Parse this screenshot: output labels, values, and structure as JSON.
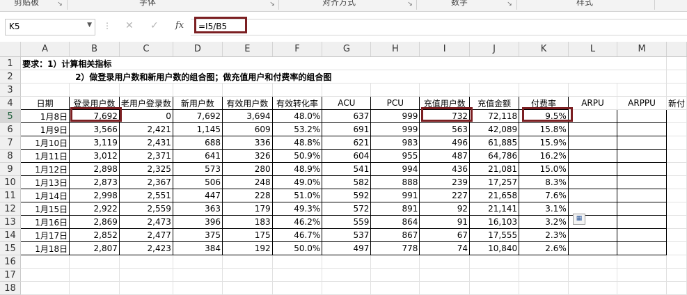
{
  "ribbon": {
    "groups": [
      "剪贴板",
      "字体",
      "对齐方式",
      "数字",
      "样式"
    ]
  },
  "formula_bar": {
    "name_box": "K5",
    "cancel_icon": "✕",
    "enter_icon": "✓",
    "fx_label": "fx",
    "formula": "=I5/B5"
  },
  "sheet": {
    "columns": [
      "A",
      "B",
      "C",
      "D",
      "E",
      "F",
      "G",
      "H",
      "I",
      "J",
      "K",
      "L",
      "M",
      ""
    ],
    "rows": [
      "1",
      "2",
      "3",
      "4",
      "5",
      "6",
      "7",
      "8",
      "9",
      "10",
      "11",
      "12",
      "13",
      "14",
      "15",
      "16",
      "17",
      "18"
    ],
    "requirement_line1": "要求：1）计算相关指标",
    "requirement_line2": "2）做登录用户数和新用户数的组合图；做充值用户和付费率的组合图",
    "headers": [
      "日期",
      "登录用户数",
      "老用户登录数",
      "新用户数",
      "有效用户数",
      "有效转化率",
      "ACU",
      "PCU",
      "充值用户数",
      "充值金额",
      "付费率",
      "ARPU",
      "ARPPU",
      "新付"
    ],
    "data": [
      [
        "1月8日",
        "7,692",
        "0",
        "7,692",
        "3,694",
        "48.0%",
        "637",
        "999",
        "732",
        "72,118",
        "9.5%"
      ],
      [
        "1月9日",
        "3,566",
        "2,421",
        "1,145",
        "609",
        "53.2%",
        "691",
        "999",
        "563",
        "42,089",
        "15.8%"
      ],
      [
        "1月10日",
        "3,119",
        "2,431",
        "688",
        "336",
        "48.8%",
        "621",
        "983",
        "496",
        "61,885",
        "15.9%"
      ],
      [
        "1月11日",
        "3,012",
        "2,371",
        "641",
        "326",
        "50.9%",
        "604",
        "955",
        "487",
        "64,786",
        "16.2%"
      ],
      [
        "1月12日",
        "2,898",
        "2,325",
        "573",
        "280",
        "48.9%",
        "541",
        "994",
        "436",
        "21,081",
        "15.0%"
      ],
      [
        "1月13日",
        "2,873",
        "2,367",
        "506",
        "248",
        "49.0%",
        "582",
        "888",
        "239",
        "17,257",
        "8.3%"
      ],
      [
        "1月14日",
        "2,998",
        "2,551",
        "447",
        "228",
        "51.0%",
        "592",
        "991",
        "227",
        "21,658",
        "7.6%"
      ],
      [
        "1月15日",
        "2,922",
        "2,559",
        "363",
        "179",
        "49.3%",
        "572",
        "891",
        "92",
        "21,141",
        "3.1%"
      ],
      [
        "1月16日",
        "2,869",
        "2,473",
        "396",
        "183",
        "46.2%",
        "559",
        "864",
        "91",
        "16,103",
        "3.2%"
      ],
      [
        "1月17日",
        "2,852",
        "2,477",
        "375",
        "175",
        "46.7%",
        "537",
        "867",
        "67",
        "17,555",
        "2.3%"
      ],
      [
        "1月18日",
        "2,807",
        "2,423",
        "384",
        "192",
        "50.0%",
        "497",
        "778",
        "74",
        "10,840",
        "2.6%"
      ]
    ]
  },
  "colors": {
    "highlight": "#7b1f22",
    "selected_header": "#d6d6d6"
  }
}
